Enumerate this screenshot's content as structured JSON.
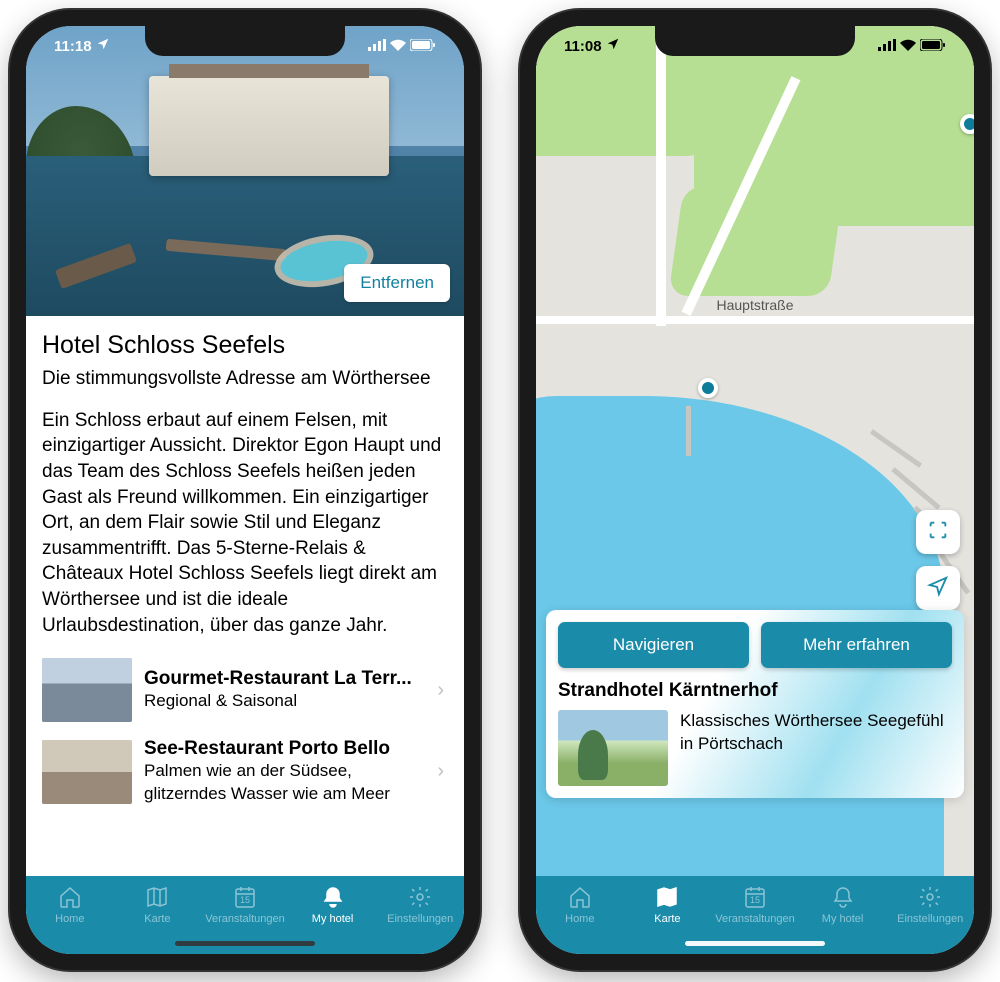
{
  "phone1": {
    "status": {
      "time": "11:18"
    },
    "remove_label": "Entfernen",
    "hotel": {
      "title": "Hotel Schloss Seefels",
      "subtitle": "Die stimmungsvollste Adresse am Wörthersee",
      "description": "Ein Schloss erbaut auf einem Felsen, mit einzigartiger Aussicht. Direktor Egon Haupt und das Team des Schloss Seefels heißen jeden Gast als Freund willkommen. Ein einzigartiger Ort, an dem Flair sowie Stil und Eleganz zusammentrifft. Das 5-Sterne-Relais & Châteaux Hotel Schloss Seefels liegt direkt am Wörthersee und ist die ideale Urlaubsdestination, über das ganze Jahr."
    },
    "rows": [
      {
        "title": "Gourmet-Restaurant La Terr...",
        "subtitle": "Regional & Saisonal"
      },
      {
        "title": "See-Restaurant Porto Bello",
        "subtitle": "Palmen wie an der Südsee, glitzerndes Wasser wie am Meer"
      }
    ],
    "tabs": {
      "home": "Home",
      "map": "Karte",
      "events": "Veranstaltungen",
      "events_badge": "15",
      "myhotel": "My hotel",
      "settings": "Einstellungen"
    }
  },
  "phone2": {
    "status": {
      "time": "11:08"
    },
    "street": "Hauptstraße",
    "actions": {
      "navigate": "Navigieren",
      "more": "Mehr erfahren"
    },
    "card": {
      "title": "Strandhotel Kärntnerhof",
      "desc": "Klassisches Wörthersee Seegefühl in Pörtschach"
    },
    "tabs": {
      "home": "Home",
      "map": "Karte",
      "events": "Veranstaltungen",
      "events_badge": "15",
      "myhotel": "My hotel",
      "settings": "Einstellungen"
    }
  }
}
